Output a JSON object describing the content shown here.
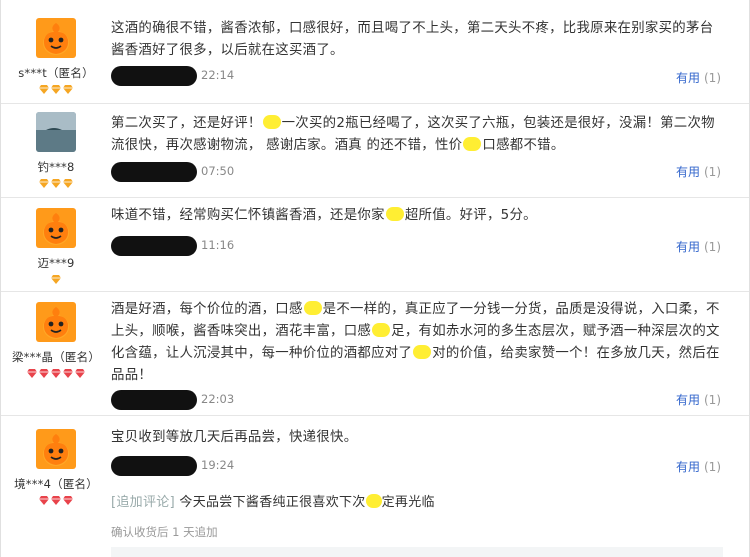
{
  "reviews": [
    {
      "username": "s***t（匿名）",
      "level_icons": 3,
      "level_color": "#f5a623",
      "avatar": "orange-mascot",
      "text_parts": [
        "这酒的确很不错，酱香浓郁，口感很好，而且喝了不上头，第二天头不疼，比我原来在别家买的茅台酱香酒好了很多，以后就在这买酒了。"
      ],
      "time": "22:14",
      "useful_label": "有用",
      "useful_count": "(1)"
    },
    {
      "username": "钓***8",
      "level_icons": 3,
      "level_color": "#f5a623",
      "avatar": "sea-photo",
      "text_parts": [
        "第二次买了，还是好评！",
        "一次买的2瓶已经喝了，这次买了六瓶，包装还是很好，没漏！第二次物流很快，再次感谢物流，  感谢店家。酒真 的还不错，性价",
        "口感都不错。"
      ],
      "time": "07:50",
      "useful_label": "有用",
      "useful_count": "(1)"
    },
    {
      "username": "迈***9",
      "level_icons": 1,
      "level_color": "#f5a623",
      "avatar": "orange-mascot",
      "text_parts": [
        "味道不错，经常购买仁怀镇酱香酒，还是你家",
        "超所值。好评，5分。"
      ],
      "time": "11:16",
      "useful_label": "有用",
      "useful_count": "(1)"
    },
    {
      "username": "梁***晶（匿名）",
      "level_icons": 5,
      "level_color": "#e8434b",
      "avatar": "orange-mascot",
      "text_parts": [
        "酒是好酒，每个价位的酒，口感",
        "是不一样的，真正应了一分钱一分货，品质是没得说，入口柔，不上头，顺喉，酱香味突出，酒花丰富，口感",
        "足，有如赤水河的多生态层次，赋予酒一种深层次的文化含蕴，让人沉浸其中，每一种价位的酒都应对了",
        "对的价值，给卖家赞一个！在多放几天，然后在品品！"
      ],
      "time": "22:03",
      "useful_label": "有用",
      "useful_count": "(1)"
    },
    {
      "username": "境***4（匿名）",
      "level_icons": 3,
      "level_color": "#e8434b",
      "avatar": "orange-mascot",
      "text_parts": [
        "宝贝收到等放几天后再品尝，快递很快。"
      ],
      "time": "19:24",
      "useful_label": "有用",
      "useful_count": "(1)"
    }
  ],
  "append_review": {
    "tag": "[追加评论]",
    "text_parts": [
      "今天品尝下酱香纯正很喜欢下次",
      "定再光临"
    ],
    "time": "确认收货后 1 天追加"
  }
}
